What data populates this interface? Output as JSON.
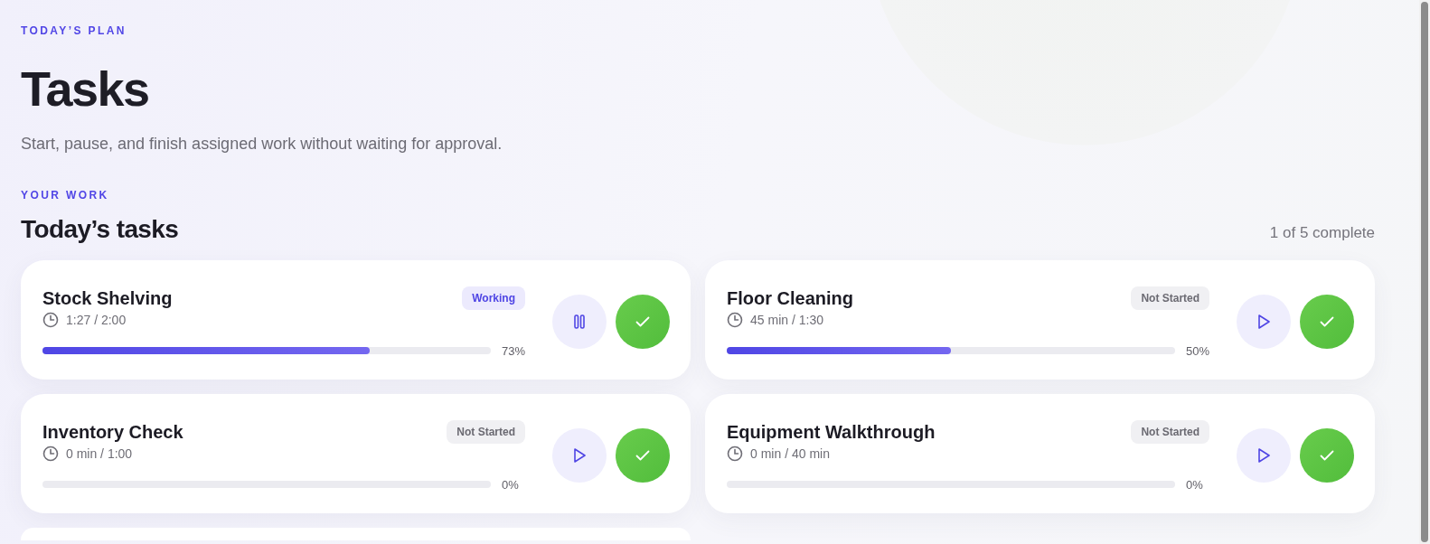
{
  "header": {
    "eyebrow": "TODAY’S PLAN",
    "title": "Tasks",
    "subtitle": "Start, pause, and finish assigned work without waiting for approval."
  },
  "section": {
    "eyebrow": "YOUR WORK",
    "title": "Today’s tasks",
    "summary": "1 of 5 complete"
  },
  "tasks": [
    {
      "name": "Stock Shelving",
      "status": "Working",
      "kind": "working",
      "time": "1:27 / 2:00",
      "level": 0.73,
      "percent": "73%"
    },
    {
      "name": "Floor Cleaning",
      "status": "Not Started",
      "kind": "not_started",
      "time": "45 min / 1:30",
      "level": 0.5,
      "percent": "50%"
    },
    {
      "name": "Inventory Check",
      "status": "Not Started",
      "kind": "not_started",
      "time": "0 min / 1:00",
      "level": 0,
      "percent": "0%"
    },
    {
      "name": "Equipment Walkthrough",
      "status": "Not Started",
      "kind": "not_started",
      "time": "0 min / 40 min",
      "level": 0,
      "percent": "0%"
    }
  ],
  "more_below": true
}
